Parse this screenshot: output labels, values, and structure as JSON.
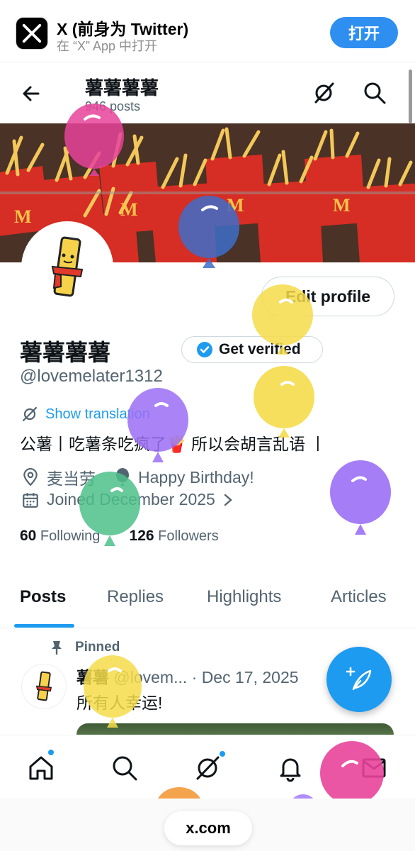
{
  "app_banner": {
    "title": "X (前身为 Twitter)",
    "subtitle": "在 “X” App 中打开",
    "open_label": "打开"
  },
  "header": {
    "name": "薯薯薯薯",
    "posts": "946 posts"
  },
  "profile": {
    "edit_label": "Edit profile",
    "name": "薯薯薯薯",
    "verified_label": "Get verified",
    "handle": "@lovemelater1312",
    "translate_label": "Show translation",
    "bio": "公薯丨吃薯条吃疯了🍟 所以会胡言乱语 丨",
    "location": "麦当劳",
    "birthday": "Happy Birthday!",
    "joined": "Joined December 2025",
    "following_count": "60",
    "following_label": "Following",
    "followers_count": "126",
    "followers_label": "Followers"
  },
  "tabs": [
    {
      "label": "Posts"
    },
    {
      "label": "Replies"
    },
    {
      "label": "Highlights"
    },
    {
      "label": "Articles"
    }
  ],
  "pinned_post": {
    "pinned_label": "Pinned",
    "name": "薯薯",
    "meta": "@lovem... · Dec 17, 2025",
    "text": "所有人幸运!"
  },
  "browser": {
    "url": "x.com"
  },
  "colors": {
    "accent": "#1d9bf0",
    "banner_button": "#2f8ff0",
    "balloon_pink": "#e8439a",
    "balloon_blue": "#3d6fc9",
    "balloon_yellow": "#f4dc4a",
    "balloon_purple": "#9b6ff5",
    "balloon_green": "#4dc08a",
    "balloon_orange": "#f39a3a"
  },
  "icons": {
    "back": "arrow-left-icon",
    "grok": "grok-icon",
    "search": "search-icon",
    "verified": "verified-badge-icon",
    "translate": "translate-icon",
    "location": "location-pin-icon",
    "birthday": "balloon-icon",
    "calendar": "calendar-icon",
    "pin": "pin-icon",
    "compose": "compose-icon",
    "home": "home-icon",
    "notifications": "bell-icon",
    "messages": "mail-icon"
  }
}
